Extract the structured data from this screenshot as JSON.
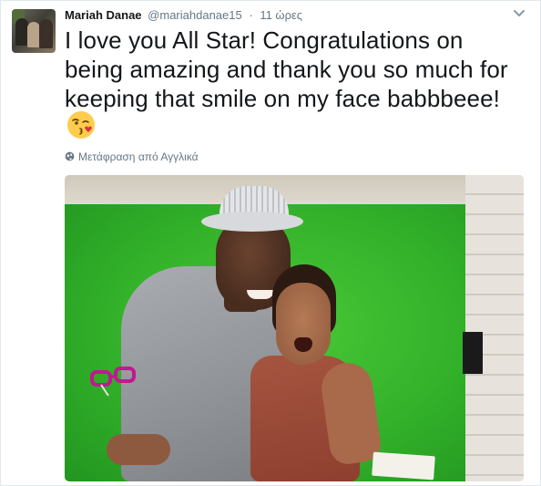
{
  "tweet": {
    "author_name": "Mariah Danae",
    "handle": "@mariahdanae15",
    "separator": "·",
    "time": "11 ώρες",
    "text": "I love you All Star! Congratulations on being amazing and thank you so much for keeping that smile on my face babbbeee!",
    "emoji": "😘",
    "translate_link": "Μετάφραση από Αγγλικά"
  },
  "icons": {
    "chevron": "chevron-down-icon",
    "globe": "globe-icon"
  },
  "colors": {
    "text": "#14171a",
    "muted": "#657786",
    "border": "#e1e8ed",
    "green_screen": "#33b12a"
  }
}
